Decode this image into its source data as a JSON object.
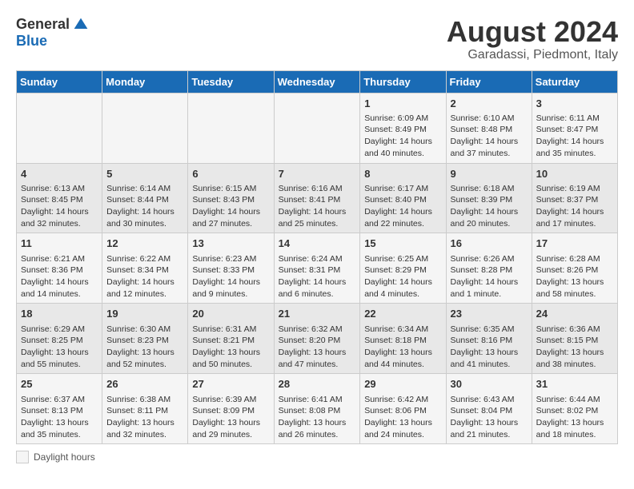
{
  "header": {
    "logo_general": "General",
    "logo_blue": "Blue",
    "title": "August 2024",
    "subtitle": "Garadassi, Piedmont, Italy"
  },
  "legend": {
    "label": "Daylight hours"
  },
  "days_of_week": [
    "Sunday",
    "Monday",
    "Tuesday",
    "Wednesday",
    "Thursday",
    "Friday",
    "Saturday"
  ],
  "weeks": [
    [
      {
        "num": "",
        "info": ""
      },
      {
        "num": "",
        "info": ""
      },
      {
        "num": "",
        "info": ""
      },
      {
        "num": "",
        "info": ""
      },
      {
        "num": "1",
        "info": "Sunrise: 6:09 AM\nSunset: 8:49 PM\nDaylight: 14 hours\nand 40 minutes."
      },
      {
        "num": "2",
        "info": "Sunrise: 6:10 AM\nSunset: 8:48 PM\nDaylight: 14 hours\nand 37 minutes."
      },
      {
        "num": "3",
        "info": "Sunrise: 6:11 AM\nSunset: 8:47 PM\nDaylight: 14 hours\nand 35 minutes."
      }
    ],
    [
      {
        "num": "4",
        "info": "Sunrise: 6:13 AM\nSunset: 8:45 PM\nDaylight: 14 hours\nand 32 minutes."
      },
      {
        "num": "5",
        "info": "Sunrise: 6:14 AM\nSunset: 8:44 PM\nDaylight: 14 hours\nand 30 minutes."
      },
      {
        "num": "6",
        "info": "Sunrise: 6:15 AM\nSunset: 8:43 PM\nDaylight: 14 hours\nand 27 minutes."
      },
      {
        "num": "7",
        "info": "Sunrise: 6:16 AM\nSunset: 8:41 PM\nDaylight: 14 hours\nand 25 minutes."
      },
      {
        "num": "8",
        "info": "Sunrise: 6:17 AM\nSunset: 8:40 PM\nDaylight: 14 hours\nand 22 minutes."
      },
      {
        "num": "9",
        "info": "Sunrise: 6:18 AM\nSunset: 8:39 PM\nDaylight: 14 hours\nand 20 minutes."
      },
      {
        "num": "10",
        "info": "Sunrise: 6:19 AM\nSunset: 8:37 PM\nDaylight: 14 hours\nand 17 minutes."
      }
    ],
    [
      {
        "num": "11",
        "info": "Sunrise: 6:21 AM\nSunset: 8:36 PM\nDaylight: 14 hours\nand 14 minutes."
      },
      {
        "num": "12",
        "info": "Sunrise: 6:22 AM\nSunset: 8:34 PM\nDaylight: 14 hours\nand 12 minutes."
      },
      {
        "num": "13",
        "info": "Sunrise: 6:23 AM\nSunset: 8:33 PM\nDaylight: 14 hours\nand 9 minutes."
      },
      {
        "num": "14",
        "info": "Sunrise: 6:24 AM\nSunset: 8:31 PM\nDaylight: 14 hours\nand 6 minutes."
      },
      {
        "num": "15",
        "info": "Sunrise: 6:25 AM\nSunset: 8:29 PM\nDaylight: 14 hours\nand 4 minutes."
      },
      {
        "num": "16",
        "info": "Sunrise: 6:26 AM\nSunset: 8:28 PM\nDaylight: 14 hours\nand 1 minute."
      },
      {
        "num": "17",
        "info": "Sunrise: 6:28 AM\nSunset: 8:26 PM\nDaylight: 13 hours\nand 58 minutes."
      }
    ],
    [
      {
        "num": "18",
        "info": "Sunrise: 6:29 AM\nSunset: 8:25 PM\nDaylight: 13 hours\nand 55 minutes."
      },
      {
        "num": "19",
        "info": "Sunrise: 6:30 AM\nSunset: 8:23 PM\nDaylight: 13 hours\nand 52 minutes."
      },
      {
        "num": "20",
        "info": "Sunrise: 6:31 AM\nSunset: 8:21 PM\nDaylight: 13 hours\nand 50 minutes."
      },
      {
        "num": "21",
        "info": "Sunrise: 6:32 AM\nSunset: 8:20 PM\nDaylight: 13 hours\nand 47 minutes."
      },
      {
        "num": "22",
        "info": "Sunrise: 6:34 AM\nSunset: 8:18 PM\nDaylight: 13 hours\nand 44 minutes."
      },
      {
        "num": "23",
        "info": "Sunrise: 6:35 AM\nSunset: 8:16 PM\nDaylight: 13 hours\nand 41 minutes."
      },
      {
        "num": "24",
        "info": "Sunrise: 6:36 AM\nSunset: 8:15 PM\nDaylight: 13 hours\nand 38 minutes."
      }
    ],
    [
      {
        "num": "25",
        "info": "Sunrise: 6:37 AM\nSunset: 8:13 PM\nDaylight: 13 hours\nand 35 minutes."
      },
      {
        "num": "26",
        "info": "Sunrise: 6:38 AM\nSunset: 8:11 PM\nDaylight: 13 hours\nand 32 minutes."
      },
      {
        "num": "27",
        "info": "Sunrise: 6:39 AM\nSunset: 8:09 PM\nDaylight: 13 hours\nand 29 minutes."
      },
      {
        "num": "28",
        "info": "Sunrise: 6:41 AM\nSunset: 8:08 PM\nDaylight: 13 hours\nand 26 minutes."
      },
      {
        "num": "29",
        "info": "Sunrise: 6:42 AM\nSunset: 8:06 PM\nDaylight: 13 hours\nand 24 minutes."
      },
      {
        "num": "30",
        "info": "Sunrise: 6:43 AM\nSunset: 8:04 PM\nDaylight: 13 hours\nand 21 minutes."
      },
      {
        "num": "31",
        "info": "Sunrise: 6:44 AM\nSunset: 8:02 PM\nDaylight: 13 hours\nand 18 minutes."
      }
    ]
  ]
}
